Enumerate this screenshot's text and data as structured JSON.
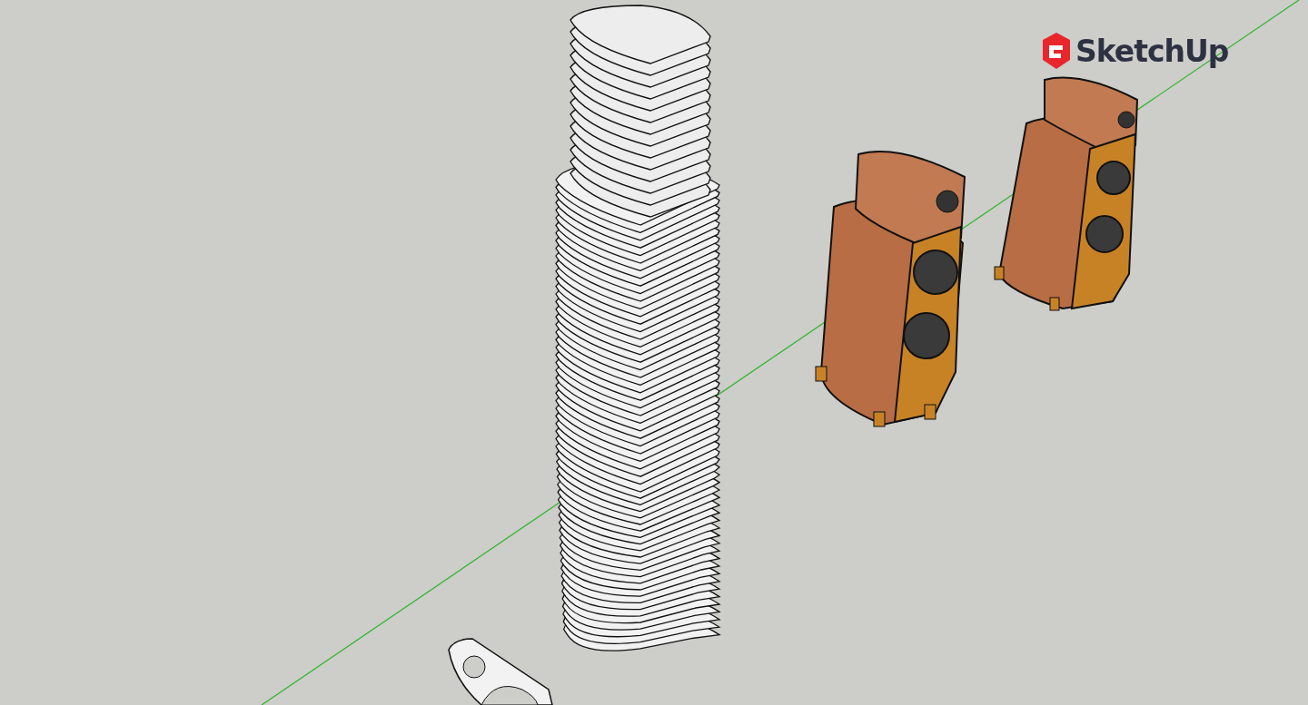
{
  "viewport": {
    "logo_text": "SketchUp"
  }
}
